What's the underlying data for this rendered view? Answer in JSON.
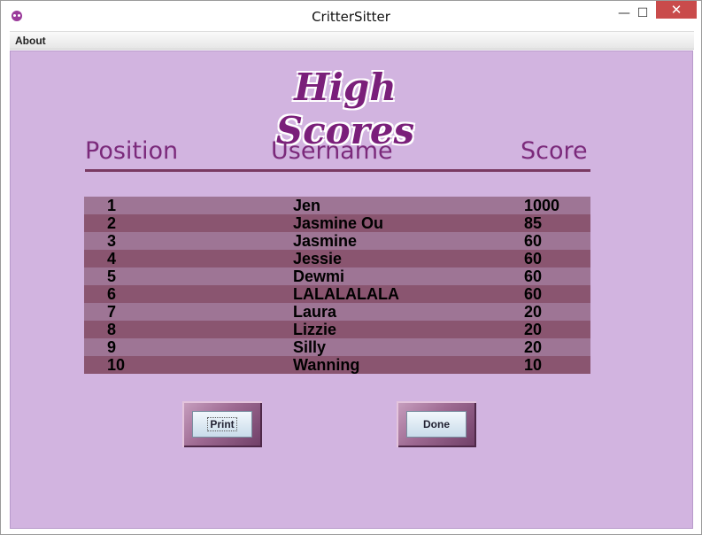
{
  "window": {
    "title": "CritterSitter"
  },
  "controls": {
    "minimize": "—",
    "maximize": "☐",
    "close": "✕"
  },
  "menu": {
    "about": "About"
  },
  "page": {
    "heading": "High Scores"
  },
  "columns": {
    "position": "Position",
    "username": "Username",
    "score": "Score"
  },
  "scores": [
    {
      "position": "1",
      "username": "Jen",
      "score": "1000"
    },
    {
      "position": "2",
      "username": "Jasmine Ou",
      "score": "85"
    },
    {
      "position": "3",
      "username": "Jasmine",
      "score": "60"
    },
    {
      "position": "4",
      "username": "Jessie",
      "score": "60"
    },
    {
      "position": "5",
      "username": "Dewmi",
      "score": "60"
    },
    {
      "position": "6",
      "username": "LALALALALA",
      "score": "60"
    },
    {
      "position": "7",
      "username": "Laura",
      "score": "20"
    },
    {
      "position": "8",
      "username": "Lizzie",
      "score": "20"
    },
    {
      "position": "9",
      "username": "Silly",
      "score": "20"
    },
    {
      "position": "10",
      "username": "Wanning",
      "score": "10"
    }
  ],
  "buttons": {
    "print": "Print",
    "done": "Done"
  },
  "colors": {
    "background": "#d2b4e0",
    "heading": "#7a1f7a",
    "row_light": "#9e7595",
    "row_dark": "#8a5570"
  }
}
